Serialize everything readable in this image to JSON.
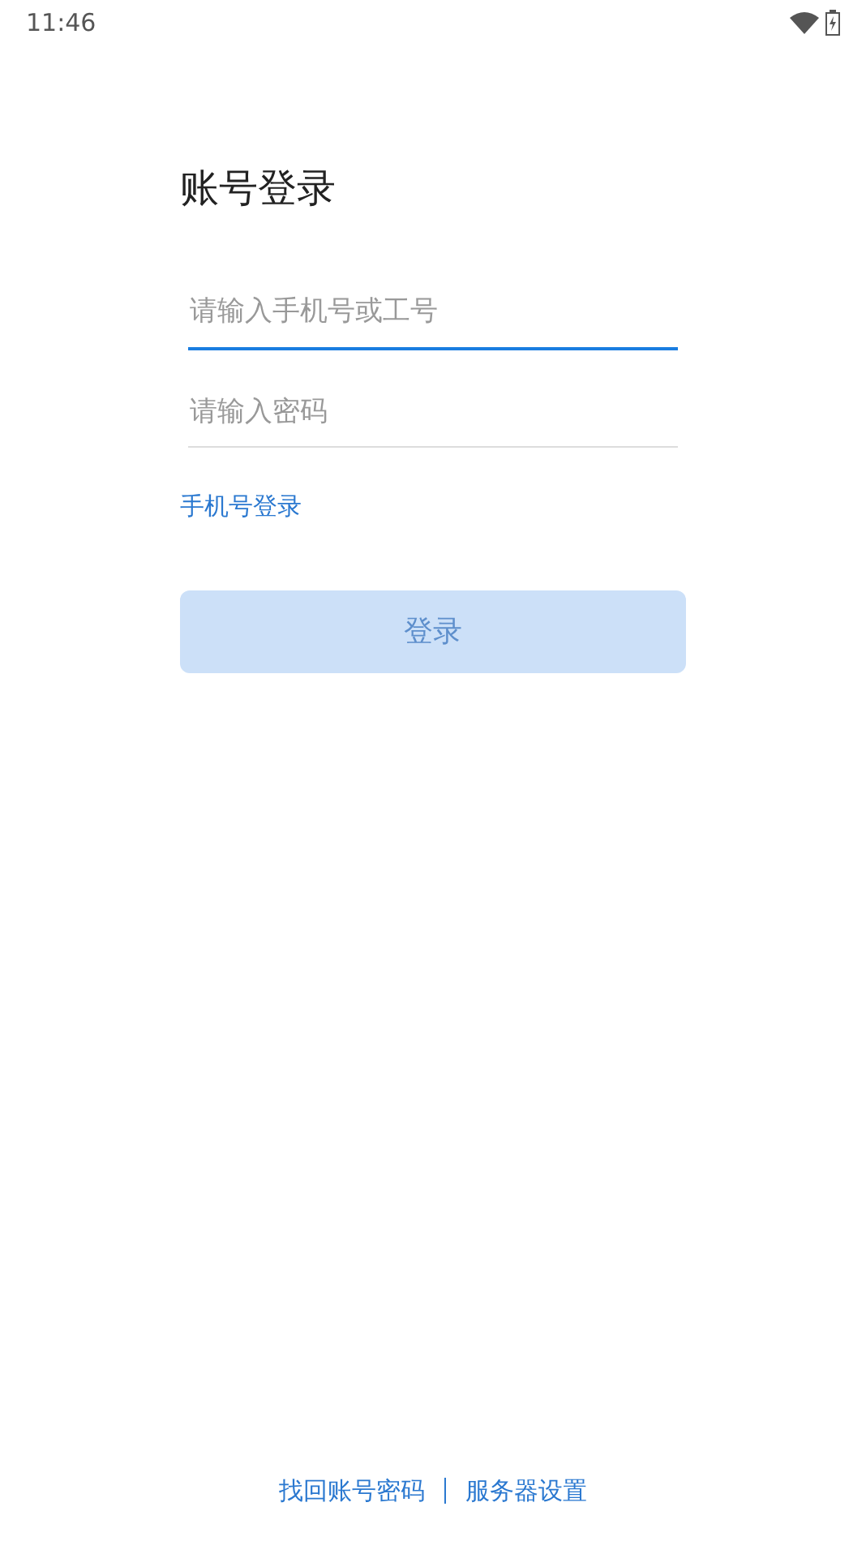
{
  "status_bar": {
    "time": "11:46"
  },
  "title": "账号登录",
  "fields": [
    {
      "placeholder": "请输入手机号或工号",
      "focused": true
    },
    {
      "placeholder": "请输入密码",
      "focused": false
    }
  ],
  "switch_link": "手机号登录",
  "login_button": {
    "label": "登录",
    "disabled": true
  },
  "footer_links": [
    "找回账号密码",
    "服务器设置"
  ]
}
